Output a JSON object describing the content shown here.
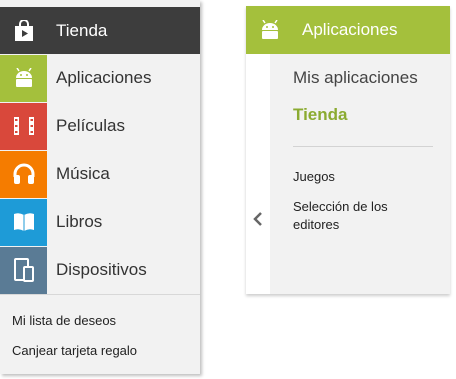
{
  "left_panel": {
    "header": {
      "label": "Tienda",
      "icon": "shopping-bag-icon",
      "color": "#3d3d3d"
    },
    "items": [
      {
        "label": "Aplicaciones",
        "icon": "android-icon",
        "color": "#a4c03c"
      },
      {
        "label": "Películas",
        "icon": "film-icon",
        "color": "#d9483b"
      },
      {
        "label": "Música",
        "icon": "headphones-icon",
        "color": "#f57c00"
      },
      {
        "label": "Libros",
        "icon": "book-icon",
        "color": "#1e9bd7"
      },
      {
        "label": "Dispositivos",
        "icon": "devices-icon",
        "color": "#5a7b95"
      }
    ],
    "links": [
      "Mi lista de deseos",
      "Canjear tarjeta regalo"
    ]
  },
  "right_panel": {
    "header": {
      "label": "Aplicaciones",
      "icon": "android-icon",
      "color": "#a4c03c"
    },
    "items": [
      "Mis aplicaciones",
      "Tienda"
    ],
    "active_item": "Tienda",
    "links": [
      "Juegos",
      "Selección de los editores"
    ],
    "back_icon": "chevron-left-icon"
  }
}
